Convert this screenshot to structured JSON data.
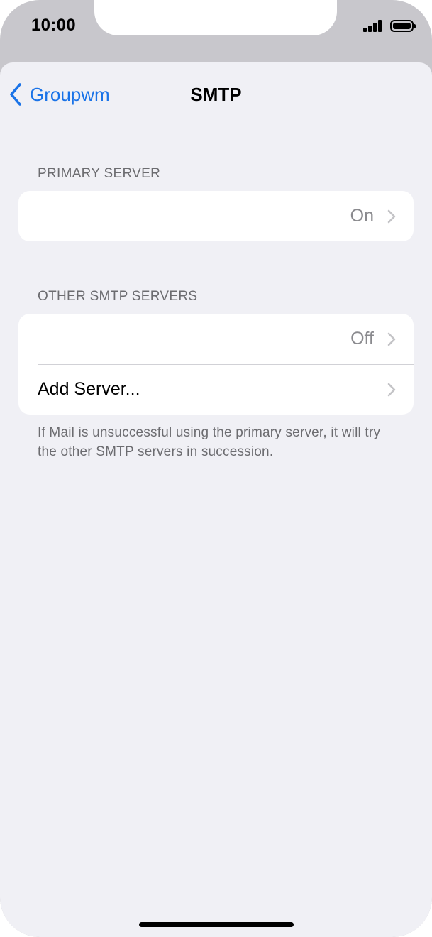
{
  "status_bar": {
    "time": "10:00"
  },
  "nav": {
    "back_label": "Groupwm",
    "title": "SMTP",
    "accent_color": "#1a73e8"
  },
  "primary_server": {
    "header": "PRIMARY SERVER",
    "row": {
      "label": "",
      "value": "On"
    }
  },
  "other_servers": {
    "header": "OTHER SMTP SERVERS",
    "rows": [
      {
        "label": "",
        "value": "Off"
      },
      {
        "label": "Add Server...",
        "value": ""
      }
    ],
    "footer": "If Mail is unsuccessful using the primary server, it will try the other SMTP servers in succession."
  },
  "icons": {
    "back": "chevron-left-icon",
    "disclosure": "chevron-right-icon",
    "signal": "cellular-signal-icon",
    "battery": "battery-icon"
  }
}
